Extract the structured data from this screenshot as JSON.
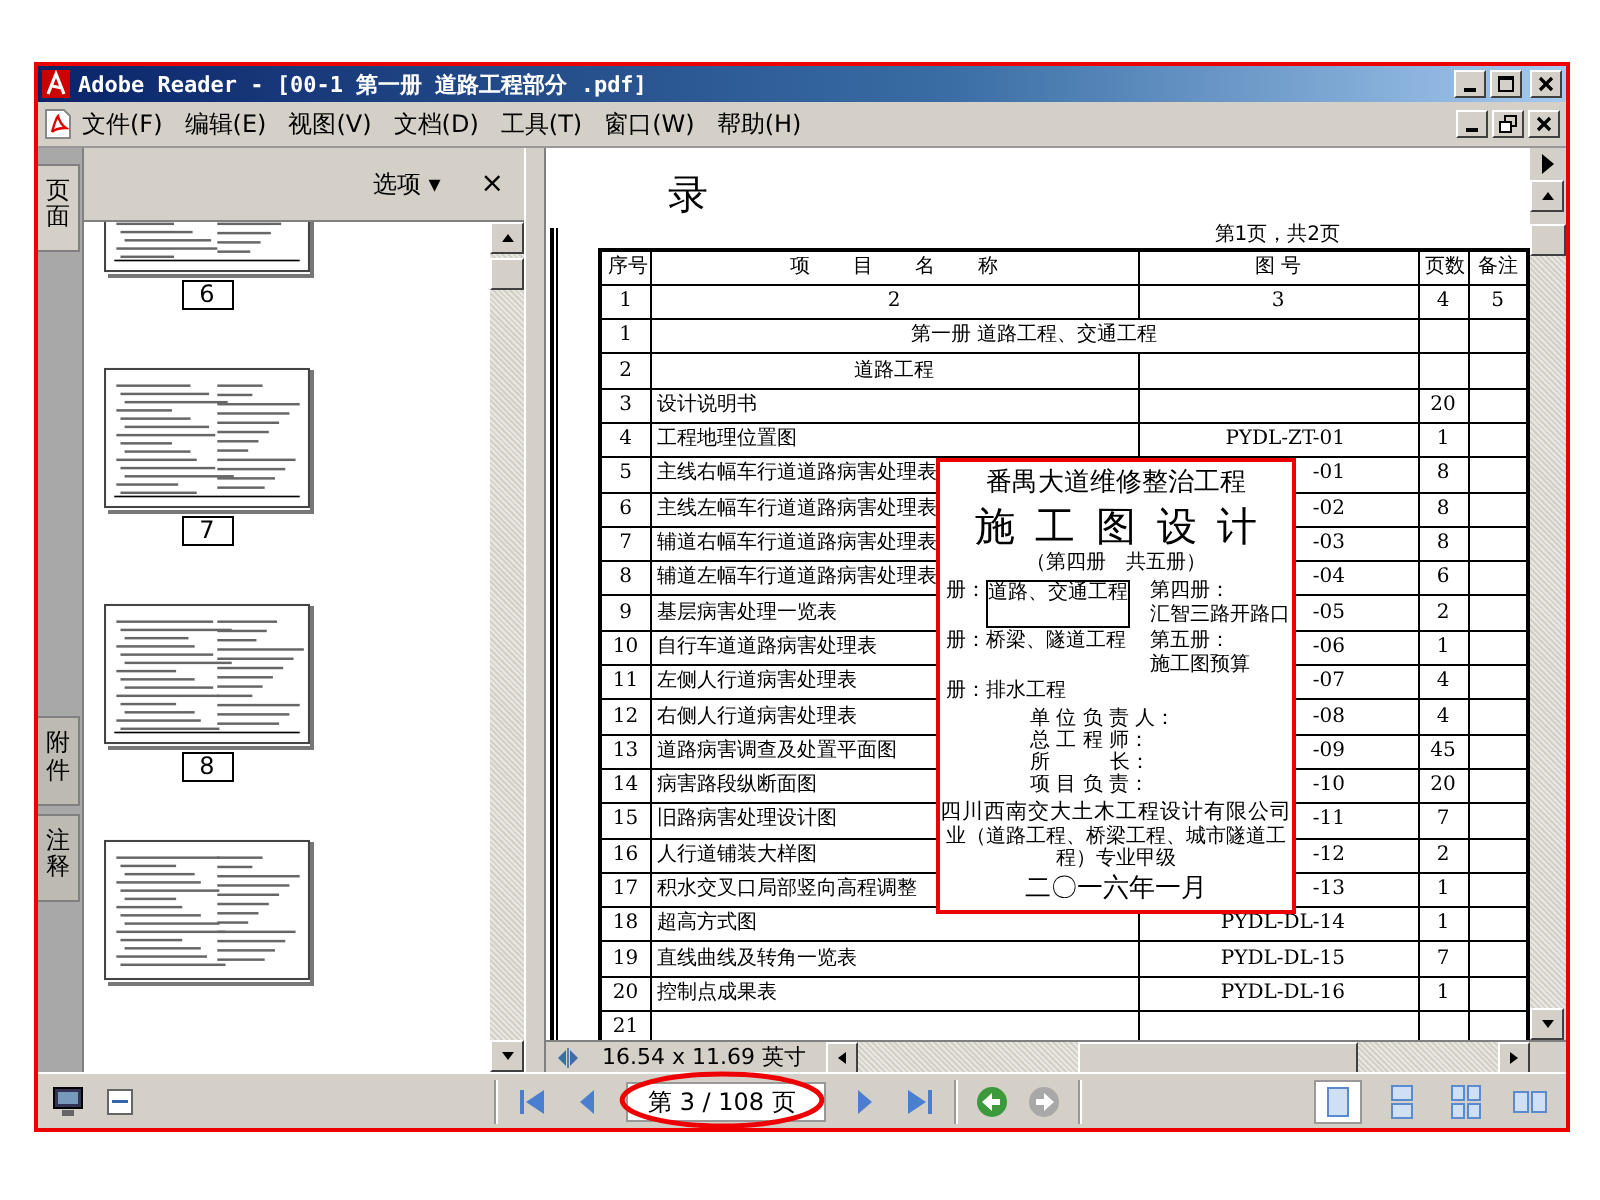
{
  "window": {
    "title": "Adobe Reader - [00-1  第一册 道路工程部分 .pdf]"
  },
  "menu": [
    "文件(F)",
    "编辑(E)",
    "视图(V)",
    "文档(D)",
    "工具(T)",
    "窗口(W)",
    "帮助(H)"
  ],
  "sidebar": {
    "tabs": [
      {
        "label": "页面",
        "selected": true
      },
      {
        "label": "附件",
        "selected": false
      },
      {
        "label": "注释",
        "selected": false
      }
    ],
    "options": "选项 ▾",
    "close": "×",
    "thumbnails": [
      "6",
      "7",
      "8"
    ]
  },
  "document": {
    "heading": "录",
    "page_note": "第1页，共2页",
    "table": {
      "columns": [
        "序号",
        "项 目 名 称",
        "图 号",
        "页数",
        "备注"
      ],
      "rows": [
        {
          "kind": "index",
          "no": "1",
          "name": "2",
          "drawing": "3",
          "pages": "4",
          "remark": "5"
        },
        {
          "kind": "section",
          "no": "1",
          "name": "第一册 道路工程、交通工程"
        },
        {
          "kind": "subsection",
          "no": "2",
          "name": "道路工程"
        },
        {
          "kind": "item",
          "no": "3",
          "name": "设计说明书",
          "pages": "20"
        },
        {
          "kind": "item",
          "no": "4",
          "name": "工程地理位置图",
          "drawing": "PYDL-ZT-01",
          "pages": "1"
        },
        {
          "kind": "item",
          "no": "5",
          "name": "主线右幅车行道道路病害处理表",
          "drawing": "-01",
          "pages": "8"
        },
        {
          "kind": "item",
          "no": "6",
          "name": "主线左幅车行道道路病害处理表",
          "drawing": "-02",
          "pages": "8"
        },
        {
          "kind": "item",
          "no": "7",
          "name": "辅道右幅车行道道路病害处理表",
          "drawing": "-03",
          "pages": "8"
        },
        {
          "kind": "item",
          "no": "8",
          "name": "辅道左幅车行道道路病害处理表",
          "drawing": "-04",
          "pages": "6"
        },
        {
          "kind": "item",
          "no": "9",
          "name": "基层病害处理一览表",
          "drawing": "-05",
          "pages": "2"
        },
        {
          "kind": "item",
          "no": "10",
          "name": "自行车道道路病害处理表",
          "drawing": "-06",
          "pages": "1"
        },
        {
          "kind": "item",
          "no": "11",
          "name": "左侧人行道病害处理表",
          "drawing": "-07",
          "pages": "4"
        },
        {
          "kind": "item",
          "no": "12",
          "name": "右侧人行道病害处理表",
          "drawing": "-08",
          "pages": "4"
        },
        {
          "kind": "item",
          "no": "13",
          "name": "道路病害调查及处置平面图",
          "drawing": "-09",
          "pages": "45"
        },
        {
          "kind": "item",
          "no": "14",
          "name": "病害路段纵断面图",
          "drawing": "-10",
          "pages": "20"
        },
        {
          "kind": "item",
          "no": "15",
          "name": "旧路病害处理设计图",
          "drawing": "-11",
          "pages": "7"
        },
        {
          "kind": "item",
          "no": "16",
          "name": "人行道铺装大样图",
          "drawing": "-12",
          "pages": "2"
        },
        {
          "kind": "item",
          "no": "17",
          "name": "积水交叉口局部竖向高程调整",
          "drawing": "-13",
          "pages": "1"
        },
        {
          "kind": "item",
          "no": "18",
          "name": "超高方式图",
          "drawing": "PYDL-DL-14",
          "pages": "1"
        },
        {
          "kind": "item",
          "no": "19",
          "name": "直线曲线及转角一览表",
          "drawing": "PYDL-DL-15",
          "pages": "7"
        },
        {
          "kind": "item",
          "no": "20",
          "name": "控制点成果表",
          "drawing": "PYDL-DL-16",
          "pages": "1"
        },
        {
          "kind": "item",
          "no": "21"
        }
      ]
    }
  },
  "cover_sheet": {
    "project": "番禺大道维修整治工程",
    "title": "施 工 图 设 计",
    "volume": "（第四册　共五册）",
    "volumes": [
      {
        "prefix": "册：",
        "name": "道路、交通工程",
        "boxed": true
      },
      {
        "prefix": "第四册：",
        "name": "汇智三路开路口",
        "boxed": false
      },
      {
        "prefix": "册：",
        "name": "桥梁、隧道工程",
        "boxed": false
      },
      {
        "prefix": "第五册：",
        "name": "施工图预算",
        "boxed": false
      },
      {
        "prefix": "册：",
        "name": "排水工程",
        "boxed": false
      }
    ],
    "signatures": [
      "单 位 负 责 人：",
      "总 工 程 师：",
      "所　　　长：",
      "项 目 负 责："
    ],
    "company": "四川西南交大土木工程设计有限公司",
    "qualification": "业（道路工程、桥梁工程、城市隧道工程）专业甲级",
    "date": "二〇一六年一月"
  },
  "status_bar": {
    "page_size": "16.54 x 11.69 英寸"
  },
  "toolbar": {
    "page_field": "第 3 / 108 页",
    "back_enabled": true,
    "forward_enabled": false,
    "view_modes": [
      {
        "kind": "single",
        "selected": true
      },
      {
        "kind": "continuous",
        "selected": false
      },
      {
        "kind": "grid",
        "selected": false
      },
      {
        "kind": "facing",
        "selected": false
      }
    ]
  }
}
